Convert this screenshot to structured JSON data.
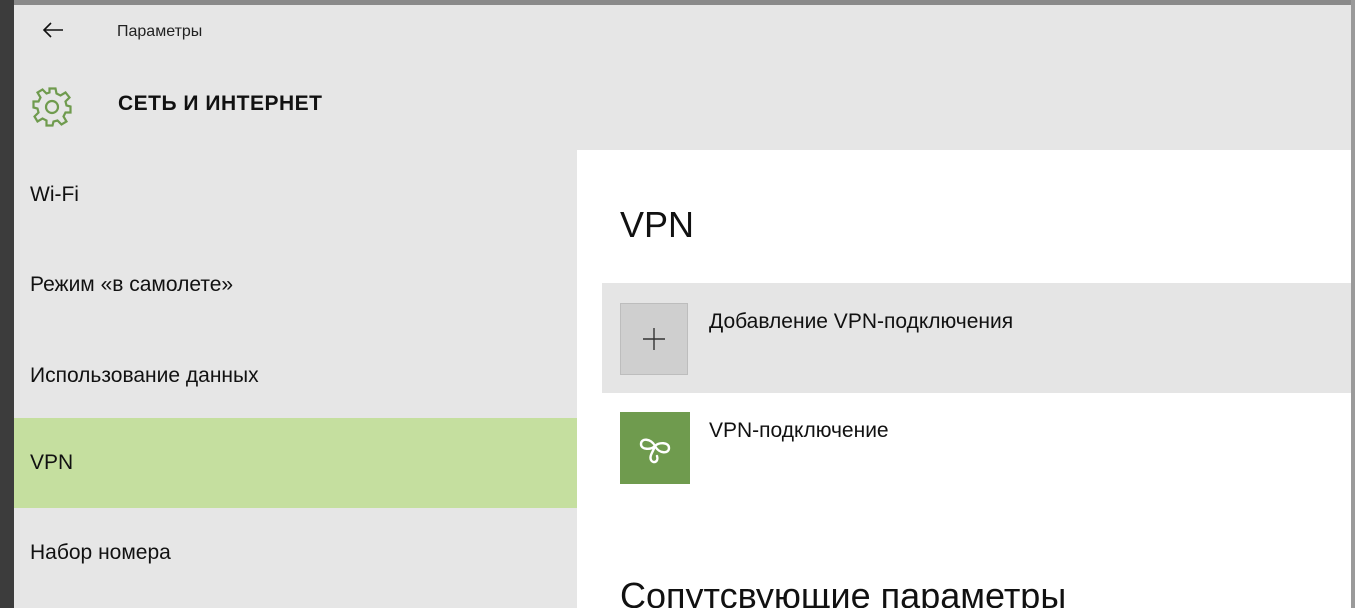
{
  "window": {
    "title": "Параметры"
  },
  "header": {
    "title": "СЕТЬ И ИНТЕРНЕТ",
    "icon": "gear-icon",
    "accent_color": "#6f9b4e"
  },
  "sidebar": {
    "items": [
      {
        "label": "Wi-Fi",
        "selected": false
      },
      {
        "label": "Режим «в самолете»",
        "selected": false
      },
      {
        "label": "Использование данных",
        "selected": false
      },
      {
        "label": "VPN",
        "selected": true
      },
      {
        "label": "Набор номера",
        "selected": false
      }
    ],
    "selected_color": "#c5df9f"
  },
  "main": {
    "title": "VPN",
    "add_connection": {
      "label": "Добавление VPN-подключения",
      "icon": "plus-icon"
    },
    "connections": [
      {
        "label": "VPN-подключение",
        "icon": "vpn-icon"
      }
    ],
    "related_title": "Сопутсвующие параметры"
  }
}
